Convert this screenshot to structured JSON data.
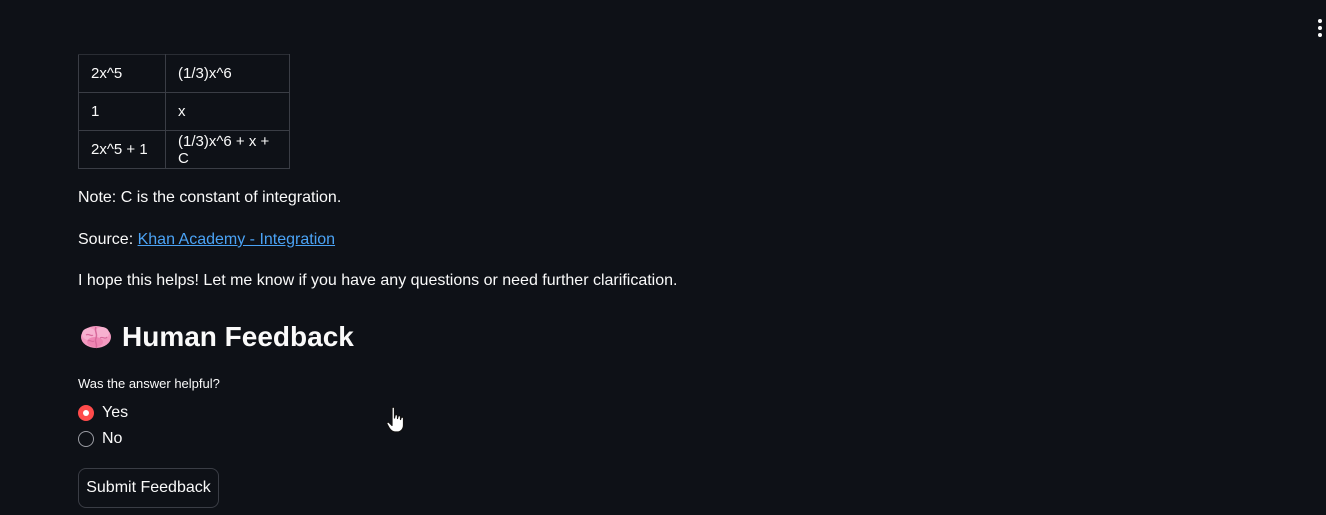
{
  "table": {
    "rows": [
      [
        "2x^5",
        "(1/3)x^6"
      ],
      [
        "1",
        "x"
      ],
      [
        "2x^5 + 1",
        "(1/3)x^6 + x + C"
      ]
    ]
  },
  "note": "Note: C is the constant of integration.",
  "source": {
    "prefix": "Source: ",
    "link_text": "Khan Academy - Integration"
  },
  "closing": "I hope this helps! Let me know if you have any questions or need further clarification.",
  "feedback": {
    "heading_icon": "brain-icon",
    "heading": "Human Feedback",
    "question": "Was the answer helpful?",
    "options": [
      {
        "label": "Yes",
        "selected": true
      },
      {
        "label": "No",
        "selected": false
      }
    ],
    "submit_label": "Submit Feedback"
  },
  "colors": {
    "background": "#0e1117",
    "link": "#4ba3f5",
    "radio_selected": "#ff4b4b"
  },
  "icons": {
    "menu": "kebab-menu-icon",
    "cursor": "hand-pointer-icon"
  }
}
